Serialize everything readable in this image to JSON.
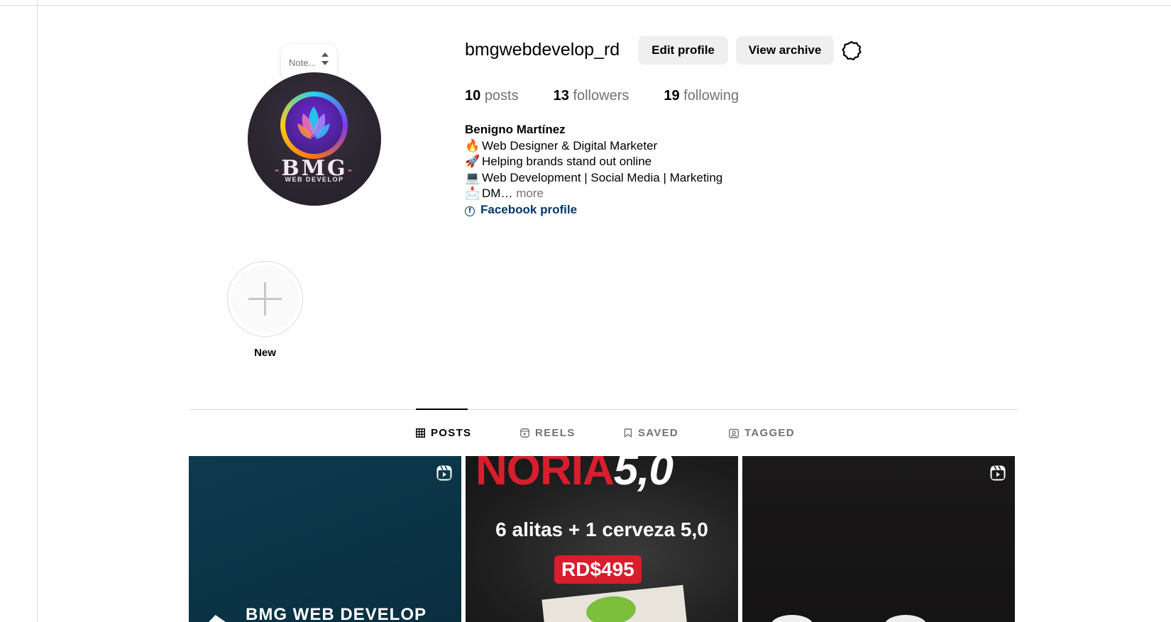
{
  "profile": {
    "username": "bmgwebdevelop_rd",
    "note_placeholder": "Note...",
    "avatar": {
      "brand": "BMG",
      "tagline": "WEB DEVELOP"
    },
    "buttons": {
      "edit": "Edit profile",
      "archive": "View archive"
    },
    "stats": [
      {
        "count": "10",
        "label": "posts"
      },
      {
        "count": "13",
        "label": "followers"
      },
      {
        "count": "19",
        "label": "following"
      }
    ],
    "bio": {
      "name": "Benigno Martínez",
      "lines": [
        {
          "icon": "fire-emoji",
          "glyph": "🔥",
          "text": "Web Designer & Digital Marketer"
        },
        {
          "icon": "rocket-emoji",
          "glyph": "🚀",
          "text": "Helping brands stand out online"
        },
        {
          "icon": "laptop-emoji",
          "glyph": "💻",
          "text": "Web Development | Social Media | Marketing"
        },
        {
          "icon": "inbox-emoji",
          "glyph": "📩",
          "text": "DM…"
        }
      ],
      "more": "more",
      "link": "Facebook profile"
    }
  },
  "highlights": {
    "new_label": "New"
  },
  "tabs": [
    {
      "id": "posts",
      "label": "POSTS",
      "active": true
    },
    {
      "id": "reels",
      "label": "REELS",
      "active": false
    },
    {
      "id": "saved",
      "label": "SAVED",
      "active": false
    },
    {
      "id": "tagged",
      "label": "TAGGED",
      "active": false
    }
  ],
  "posts": [
    {
      "type": "reel",
      "overlay_text": "BMG WEB DEVELOP"
    },
    {
      "type": "image",
      "headline": "NORIA",
      "headline_accent": "5,0",
      "line": "6 alitas + 1 cerveza 5,0",
      "price": "RD$495"
    },
    {
      "type": "reel"
    }
  ],
  "colors": {
    "link": "#00376b",
    "muted": "#737373",
    "button_bg": "#efefef",
    "accent_red": "#d81e2c"
  }
}
